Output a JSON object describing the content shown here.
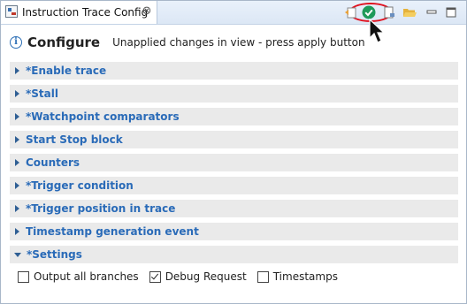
{
  "tab": {
    "title": "Instruction Trace Config",
    "close_glyph": "⊗"
  },
  "toolbar": {
    "icons": [
      "undo-changes-icon",
      "apply-icon",
      "export-icon",
      "open-folder-icon",
      "minimize-icon",
      "maximize-icon"
    ],
    "apply_color": "#1f9a5a",
    "highlight_color": "#e0101e"
  },
  "header": {
    "title": "Configure",
    "status": "Unapplied changes in view - press apply button"
  },
  "sections": [
    {
      "label": "*Enable trace",
      "expanded": false
    },
    {
      "label": "*Stall",
      "expanded": false
    },
    {
      "label": "*Watchpoint comparators",
      "expanded": false
    },
    {
      "label": "Start Stop block",
      "expanded": false
    },
    {
      "label": "Counters",
      "expanded": false
    },
    {
      "label": "*Trigger condition",
      "expanded": false
    },
    {
      "label": "*Trigger position in trace",
      "expanded": false
    },
    {
      "label": "Timestamp generation event",
      "expanded": false
    },
    {
      "label": "*Settings",
      "expanded": true
    }
  ],
  "settings": {
    "checkboxes": [
      {
        "label": "Output all branches",
        "checked": false
      },
      {
        "label": "Debug Request",
        "checked": true
      },
      {
        "label": "Timestamps",
        "checked": false
      }
    ]
  },
  "colors": {
    "section_label": "#2a6bb8",
    "section_bg": "#eaeaea"
  }
}
